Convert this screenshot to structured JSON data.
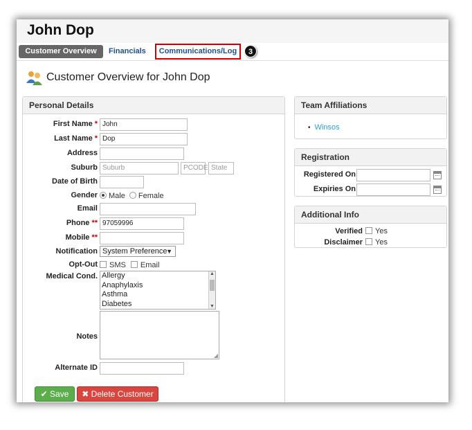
{
  "customer_name": "John Dop",
  "tabs": [
    {
      "label": "Customer Overview"
    },
    {
      "label": "Financials"
    },
    {
      "label": "Communications/Log"
    }
  ],
  "step_badge": "3",
  "heading": "Customer Overview for John Dop",
  "personal": {
    "title": "Personal Details",
    "first_name_label": "First Name",
    "first_name_value": "John",
    "last_name_label": "Last Name",
    "last_name_value": "Dop",
    "address_label": "Address",
    "suburb_label": "Suburb",
    "suburb_placeholder": "Suburb",
    "pcode_placeholder": "PCODE",
    "state_placeholder": "State",
    "dob_label": "Date of Birth",
    "gender_label": "Gender",
    "gender_male": "Male",
    "gender_female": "Female",
    "email_label": "Email",
    "phone_label": "Phone",
    "phone_value": "97059996",
    "mobile_label": "Mobile",
    "notification_label": "Notification",
    "notification_value": "System Preference",
    "optout_label": "Opt-Out",
    "optout_sms": "SMS",
    "optout_email": "Email",
    "medical_label": "Medical Cond.",
    "medical_options": [
      "Allergy",
      "Anaphylaxis",
      "Asthma",
      "Diabetes"
    ],
    "notes_label": "Notes",
    "alt_id_label": "Alternate ID",
    "required_star": "*",
    "required_double": "**",
    "save_label": "Save",
    "delete_label": "Delete Customer"
  },
  "team": {
    "title": "Team Affiliations",
    "items": [
      "Winsos"
    ]
  },
  "registration": {
    "title": "Registration",
    "registered_label": "Registered On",
    "expiries_label": "Expiries On"
  },
  "additional": {
    "title": "Additional Info",
    "verified_label": "Verified",
    "disclaimer_label": "Disclaimer",
    "yes": "Yes"
  },
  "colors": {
    "required": "#cc0000",
    "save_button": "#5cae4c",
    "delete_button": "#d9453f",
    "link": "#2a9fd6",
    "highlight_box": "#cc0000"
  },
  "icons": {
    "heading": "people-icon",
    "save": "checkmark-icon",
    "delete": "x-icon",
    "calendar": "calendar-icon",
    "select": "chevron-down-icon"
  }
}
